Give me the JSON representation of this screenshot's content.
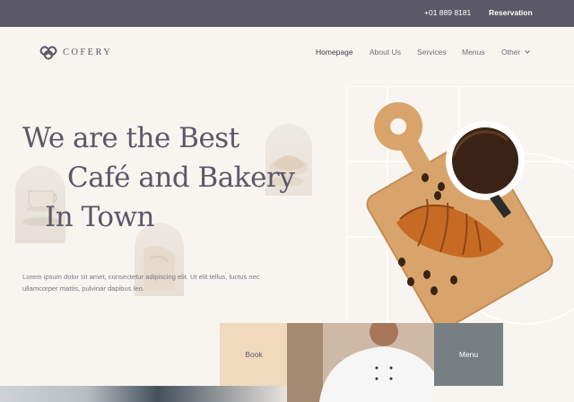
{
  "topbar": {
    "phone": "+01 889 8181",
    "reservation_label": "Reservation"
  },
  "brand": {
    "name": "COFERY"
  },
  "nav": {
    "items": [
      {
        "label": "Homepage",
        "active": true
      },
      {
        "label": "About Us"
      },
      {
        "label": "Services"
      },
      {
        "label": "Menus"
      },
      {
        "label": "Other"
      }
    ]
  },
  "hero": {
    "line1": "We are the Best",
    "line2": "Café and Bakery",
    "line3": "In Town",
    "description": "Lorem ipsum dolor sit amet, consectetur adipiscing elit. Ut elit tellus, luctus nec ullamcorper mattis, pulvinar dapibus leo."
  },
  "tiles": {
    "book_label": "Book",
    "menu_label": "Menu"
  },
  "colors": {
    "topbar": "#5b5867",
    "heading": "#5b5867",
    "book_tile": "#f0d9bd",
    "menu_tile": "#777f83",
    "background": "#f8f5f1"
  }
}
